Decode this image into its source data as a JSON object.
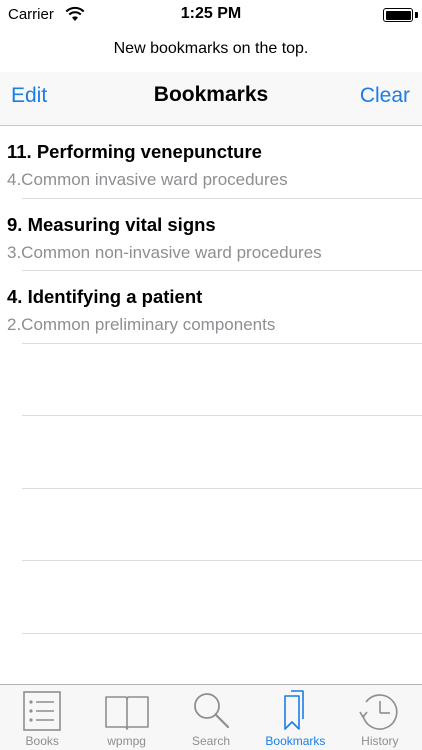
{
  "status_bar": {
    "carrier": "Carrier",
    "time": "1:25 PM"
  },
  "prompt": "New bookmarks on the top.",
  "navbar": {
    "edit_label": "Edit",
    "title": "Bookmarks",
    "clear_label": "Clear"
  },
  "bookmarks": [
    {
      "title": "11. Performing venepuncture",
      "subtitle": "4.Common invasive ward procedures"
    },
    {
      "title": "9. Measuring vital signs",
      "subtitle": "3.Common non-invasive ward procedures"
    },
    {
      "title": "4. Identifying a patient",
      "subtitle": "2.Common preliminary components"
    }
  ],
  "tabs": [
    {
      "label": "Books",
      "icon": "list-icon"
    },
    {
      "label": "wpmpg",
      "icon": "book-icon"
    },
    {
      "label": "Search",
      "icon": "search-icon"
    },
    {
      "label": "Bookmarks",
      "icon": "bookmarks-icon",
      "active": true
    },
    {
      "label": "History",
      "icon": "history-icon"
    }
  ],
  "colors": {
    "accent": "#1a7ee6",
    "subtitle": "#8e8e93",
    "separator": "#dcdcdc"
  }
}
